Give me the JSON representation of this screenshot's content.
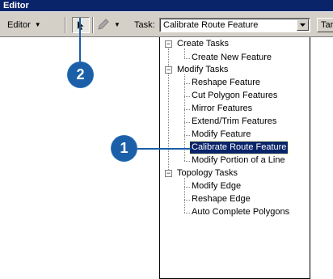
{
  "window": {
    "title": "Editor"
  },
  "toolbar": {
    "editor_menu_label": "Editor",
    "task_label": "Task:",
    "task_value": "Calibrate Route Feature",
    "next_button_label": "Tar"
  },
  "tree": {
    "groups": [
      {
        "label": "Create Tasks",
        "items": [
          "Create New Feature"
        ]
      },
      {
        "label": "Modify Tasks",
        "items": [
          "Reshape Feature",
          "Cut Polygon Features",
          "Mirror Features",
          "Extend/Trim Features",
          "Modify Feature",
          "Calibrate Route Feature",
          "Modify Portion of a Line"
        ]
      },
      {
        "label": "Topology Tasks",
        "items": [
          "Modify Edge",
          "Reshape Edge",
          "Auto Complete Polygons"
        ]
      }
    ],
    "selected": "Calibrate Route Feature",
    "toggle_symbol": "−"
  },
  "callouts": {
    "one": "1",
    "two": "2"
  },
  "colors": {
    "callout": "#1a5fa8",
    "selection": "#0a246a",
    "title_bar": "#0a246a"
  }
}
